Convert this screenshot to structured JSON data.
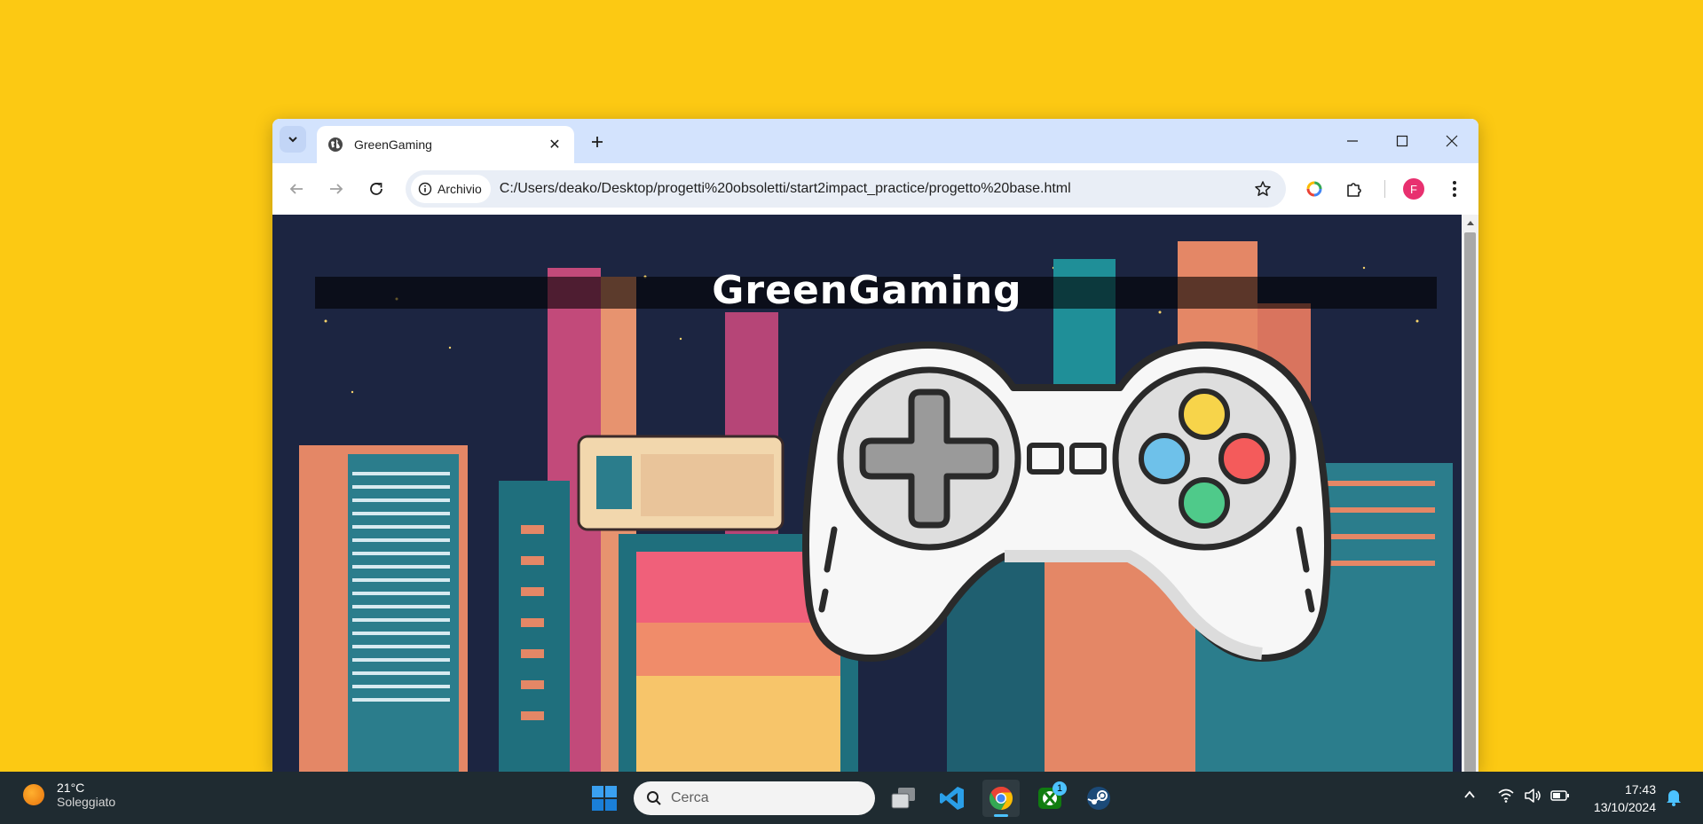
{
  "browser": {
    "tab_title": "GreenGaming",
    "site_chip_label": "Archivio",
    "url": "C:/Users/deako/Desktop/progetti%20obsoletti/start2impact_practice/progetto%20base.html",
    "profile_initial": "F"
  },
  "page": {
    "title": "GreenGaming"
  },
  "taskbar": {
    "weather_temp": "21°C",
    "weather_desc": "Soleggiato",
    "search_placeholder": "Cerca",
    "xbox_badge": "1",
    "time": "17:43",
    "date": "13/10/2024"
  },
  "colors": {
    "desktop_bg": "#fcc913",
    "tabbar_bg": "#d3e3fd",
    "page_bg": "#1c2541",
    "taskbar_bg": "#1f2b31",
    "profile_avatar": "#e8306f"
  }
}
